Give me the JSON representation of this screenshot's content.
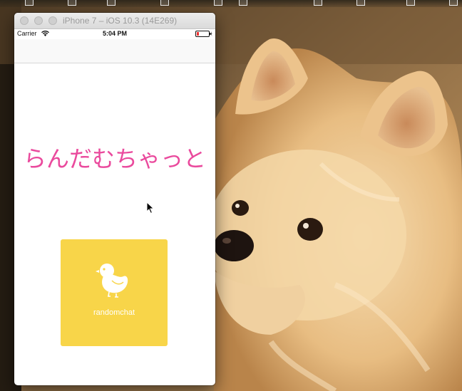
{
  "window": {
    "title": "iPhone 7 – iOS 10.3 (14E269)"
  },
  "status_bar": {
    "carrier": "Carrier",
    "time": "5:04 PM",
    "wifi_icon": "wifi-icon",
    "battery_icon": "battery-icon"
  },
  "app": {
    "title": "らんだむちゃっと",
    "title_color": "#ea4a9d",
    "start_button": {
      "label": "randomchat",
      "icon": "chick-icon",
      "color": "#f8d549"
    }
  },
  "desktop": {
    "background_icon": "dog-photo"
  }
}
